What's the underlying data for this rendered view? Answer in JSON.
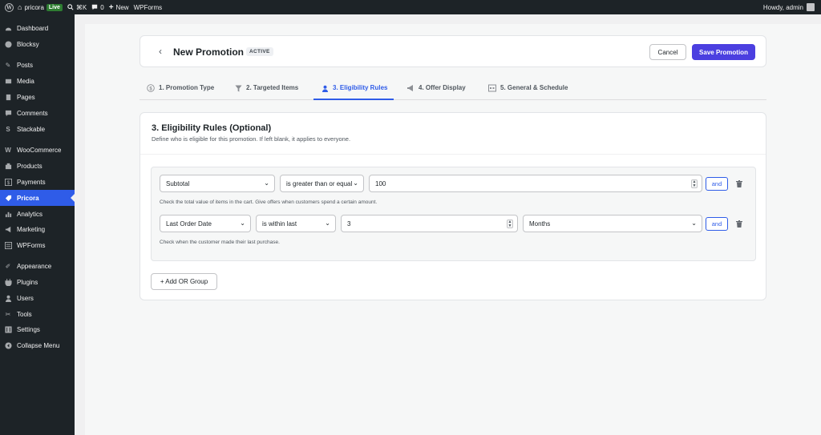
{
  "admin_bar": {
    "site_name": "pricora",
    "live_badge": "Live",
    "shortcut": "⌘K",
    "comments_count": "0",
    "new_label": "New",
    "wpforms_label": "WPForms",
    "greeting": "Howdy, admin"
  },
  "sidebar": {
    "items": [
      {
        "label": "Dashboard",
        "icon": "dashboard-icon"
      },
      {
        "label": "Blocksy",
        "icon": "blocksy-icon"
      },
      {
        "label": "Posts",
        "icon": "pin-icon"
      },
      {
        "label": "Media",
        "icon": "media-icon"
      },
      {
        "label": "Pages",
        "icon": "pages-icon"
      },
      {
        "label": "Comments",
        "icon": "comments-icon"
      },
      {
        "label": "Stackable",
        "icon": "stackable-icon"
      },
      {
        "label": "WooCommerce",
        "icon": "woocommerce-icon"
      },
      {
        "label": "Products",
        "icon": "products-icon"
      },
      {
        "label": "Payments",
        "icon": "payments-icon"
      },
      {
        "label": "Pricora",
        "icon": "pricora-icon"
      },
      {
        "label": "Analytics",
        "icon": "analytics-icon"
      },
      {
        "label": "Marketing",
        "icon": "marketing-icon"
      },
      {
        "label": "WPForms",
        "icon": "wpforms-icon"
      },
      {
        "label": "Appearance",
        "icon": "appearance-icon"
      },
      {
        "label": "Plugins",
        "icon": "plugins-icon"
      },
      {
        "label": "Users",
        "icon": "users-icon"
      },
      {
        "label": "Tools",
        "icon": "tools-icon"
      },
      {
        "label": "Settings",
        "icon": "settings-icon"
      },
      {
        "label": "Collapse Menu",
        "icon": "collapse-icon"
      }
    ],
    "active_index": 10
  },
  "header": {
    "title": "New Promotion",
    "status": "ACTIVE",
    "cancel_label": "Cancel",
    "save_label": "Save Promotion"
  },
  "tabs": [
    {
      "label": "1. Promotion Type",
      "icon": "dollar-circle-icon"
    },
    {
      "label": "2. Targeted Items",
      "icon": "filter-icon"
    },
    {
      "label": "3. Eligibility Rules",
      "icon": "user-icon"
    },
    {
      "label": "4. Offer Display",
      "icon": "megaphone-icon"
    },
    {
      "label": "5. General & Schedule",
      "icon": "calendar-icon"
    }
  ],
  "active_tab": 2,
  "rules": {
    "title": "3. Eligibility Rules (Optional)",
    "subtitle": "Define who is eligible for this promotion. If left blank, it applies to everyone.",
    "rows": [
      {
        "field": "Subtotal",
        "operator": "is greater than or equal",
        "value": "100",
        "connector": "and",
        "help": "Check the total value of items in the cart. Give offers when customers spend a certain amount."
      },
      {
        "field": "Last Order Date",
        "operator": "is within last",
        "value": "3",
        "unit": "Months",
        "connector": "and",
        "help": "Check when the customer made their last purchase."
      }
    ],
    "add_or_group_label": "+ Add OR Group"
  },
  "colors": {
    "accent": "#2f5ce8",
    "save_button": "#4b3fe0",
    "sidebar_bg": "#1d2327",
    "live_badge": "#2e7d32"
  }
}
